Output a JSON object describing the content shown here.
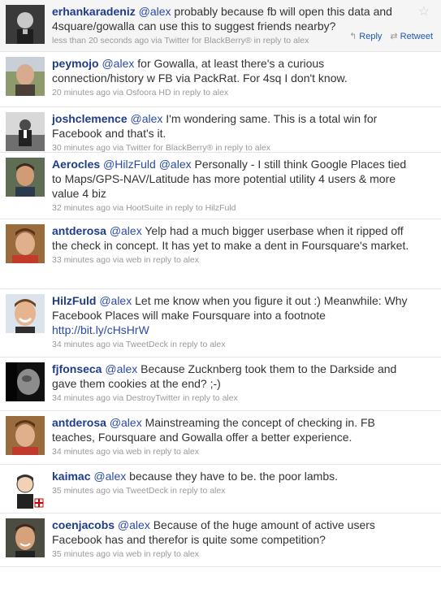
{
  "tweets": [
    {
      "user": "erhankaradeniz",
      "mentions": [
        "@alex"
      ],
      "text": "probably because fb will open this data and 4square/gowalla can use this to suggest friends nearby?",
      "link": "",
      "tail": "",
      "time": "less than 20 seconds ago",
      "via_label": "via",
      "source": "Twitter for BlackBerry®",
      "reply_label": "in reply to",
      "reply_to": "alex",
      "highlighted": true,
      "actions": {
        "reply": "Reply",
        "retweet": "Retweet"
      },
      "icons": {
        "favorite": "star-icon",
        "reply": "reply-arrow-icon",
        "retweet": "retweet-icon"
      }
    },
    {
      "user": "peymojo",
      "mentions": [
        "@alex"
      ],
      "text": "for Gowalla, at least there's a curious connection/history w FB via PackRat. For 4sq I don't know.",
      "link": "",
      "tail": "",
      "time": "20 minutes ago",
      "via_label": "via",
      "source": "Osfoora HD",
      "reply_label": "in reply to",
      "reply_to": "alex",
      "highlighted": false
    },
    {
      "user": "joshclemence",
      "mentions": [
        "@alex"
      ],
      "text": "I'm wondering same. This is a total win for Facebook and that's it.",
      "link": "",
      "tail": "",
      "time": "30 minutes ago",
      "via_label": "via",
      "source": "Twitter for BlackBerry®",
      "reply_label": "in reply to",
      "reply_to": "alex",
      "highlighted": false
    },
    {
      "user": "Aerocles",
      "mentions": [
        "@HilzFuld",
        "@alex"
      ],
      "text": "Personally - I still think Google Places tied to Maps/GPS-NAV/Latitude has more potential utility 4 users & more value 4 biz",
      "link": "",
      "tail": "",
      "time": "32 minutes ago",
      "via_label": "via",
      "source": "HootSuite",
      "reply_label": "in reply to",
      "reply_to": "HilzFuld",
      "highlighted": false
    },
    {
      "user": "antderosa",
      "mentions": [
        "@alex"
      ],
      "text": "Yelp had a much bigger userbase when it ripped off the check in concept. It has yet to make a dent in Foursquare's market.",
      "link": "",
      "tail": "",
      "time": "33 minutes ago",
      "via_label": "via",
      "source": "web",
      "reply_label": "in reply to",
      "reply_to": "alex",
      "highlighted": false
    },
    {
      "user": "HilzFuld",
      "mentions": [
        "@alex"
      ],
      "text": "Let me know when you figure it out :) Meanwhile: Why Facebook Places will make Foursquare into a footnote",
      "link": "http://bit.ly/cHsHrW",
      "tail": "",
      "time": "34 minutes ago",
      "via_label": "via",
      "source": "TweetDeck",
      "reply_label": "in reply to",
      "reply_to": "alex",
      "highlighted": false
    },
    {
      "user": "fjfonseca",
      "mentions": [
        "@alex"
      ],
      "text": "Because Zucknberg took them to the Darkside and gave them cookies at the end? ;-)",
      "link": "",
      "tail": "",
      "time": "34 minutes ago",
      "via_label": "via",
      "source": "DestroyTwitter",
      "reply_label": "in reply to",
      "reply_to": "alex",
      "highlighted": false
    },
    {
      "user": "antderosa",
      "mentions": [
        "@alex"
      ],
      "text": "Mainstreaming the concept of checking in. FB teaches, Foursquare and Gowalla offer a better experience.",
      "link": "",
      "tail": "",
      "time": "34 minutes ago",
      "via_label": "via",
      "source": "web",
      "reply_label": "in reply to",
      "reply_to": "alex",
      "highlighted": false
    },
    {
      "user": "kaimac",
      "mentions": [
        "@alex"
      ],
      "text": "because they have to be. the poor lambs.",
      "link": "",
      "tail": "",
      "time": "35 minutes ago",
      "via_label": "via",
      "source": "TweetDeck",
      "reply_label": "in reply to",
      "reply_to": "alex",
      "highlighted": false
    },
    {
      "user": "coenjacobs",
      "mentions": [
        "@alex"
      ],
      "text": "Because of the huge amount of active users Facebook has and therefor is quite some competition?",
      "link": "",
      "tail": "",
      "time": "35 minutes ago",
      "via_label": "via",
      "source": "web",
      "reply_label": "in reply to",
      "reply_to": "alex",
      "highlighted": false
    }
  ],
  "colors": {
    "screen_name": "#1f3c8a",
    "link": "#2b4aa8",
    "meta": "#999999",
    "highlight_bg": "#f5f5f5"
  }
}
